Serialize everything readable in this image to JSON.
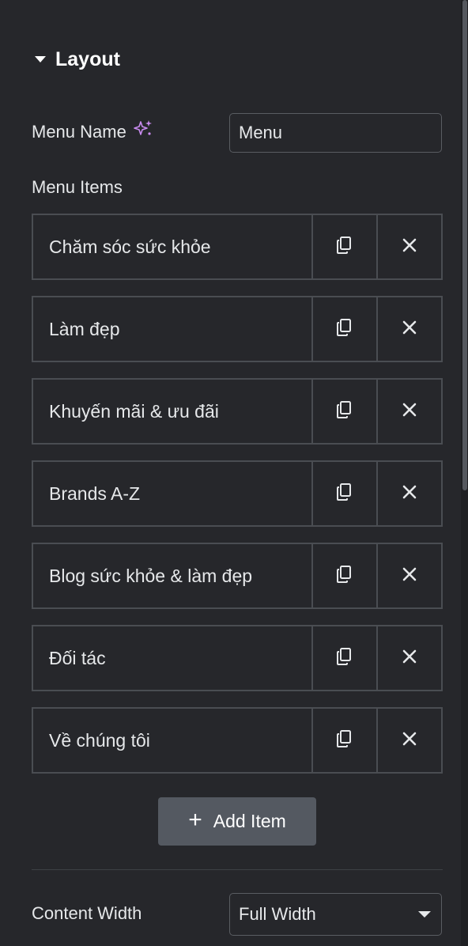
{
  "section": {
    "title": "Layout"
  },
  "menu_name": {
    "label": "Menu Name",
    "value": "Menu",
    "ai_icon": "sparkle-icon"
  },
  "menu_items": {
    "label": "Menu Items",
    "items": [
      {
        "title": "Chăm sóc sức khỏe"
      },
      {
        "title": "Làm đẹp"
      },
      {
        "title": "Khuyến mãi & ưu đãi"
      },
      {
        "title": "Brands A-Z"
      },
      {
        "title": "Blog sức khỏe & làm đẹp"
      },
      {
        "title": "Đối tác"
      },
      {
        "title": "Về chúng tôi"
      }
    ],
    "duplicate_icon": "copy-icon",
    "remove_icon": "close-icon",
    "add_label": "Add Item"
  },
  "content_width": {
    "label": "Content Width",
    "value": "Full Width"
  },
  "colors": {
    "background": "#26272b",
    "border": "#4a4d52",
    "button": "#545961",
    "ai_accent": "#c98bf0"
  }
}
